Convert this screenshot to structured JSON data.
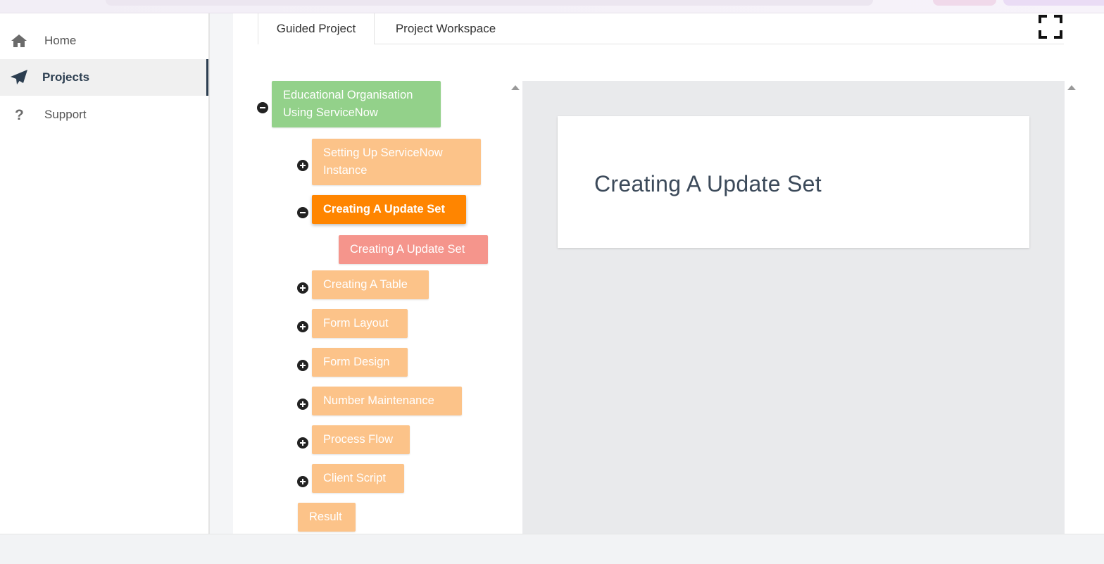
{
  "sidebar": {
    "items": [
      {
        "label": "Home",
        "icon": "home-icon"
      },
      {
        "label": "Projects",
        "icon": "paper-plane-icon",
        "active": true
      },
      {
        "label": "Support",
        "icon": "question-icon"
      }
    ]
  },
  "tabs": [
    {
      "label": "Guided Project",
      "active": true
    },
    {
      "label": "Project Workspace",
      "active": false
    }
  ],
  "tree": {
    "root": "Educational Organisation Using ServiceNow",
    "steps": [
      {
        "label": "Setting Up ServiceNow Instance",
        "expanded": false
      },
      {
        "label": "Creating A Update Set",
        "expanded": true,
        "active": true,
        "children": [
          "Creating A Update Set"
        ]
      },
      {
        "label": "Creating A Table",
        "expanded": false
      },
      {
        "label": "Form Layout",
        "expanded": false
      },
      {
        "label": "Form Design",
        "expanded": false
      },
      {
        "label": "Number Maintenance",
        "expanded": false
      },
      {
        "label": "Process Flow",
        "expanded": false
      },
      {
        "label": "Client Script",
        "expanded": false
      }
    ],
    "result": "Result"
  },
  "content": {
    "title": "Creating A Update Set"
  },
  "colors": {
    "root_node": "#93d18a",
    "step_node": "#fcc389",
    "active_node": "#ff8500",
    "child_node": "#f5958c",
    "nav_accent": "#2c3e50"
  }
}
